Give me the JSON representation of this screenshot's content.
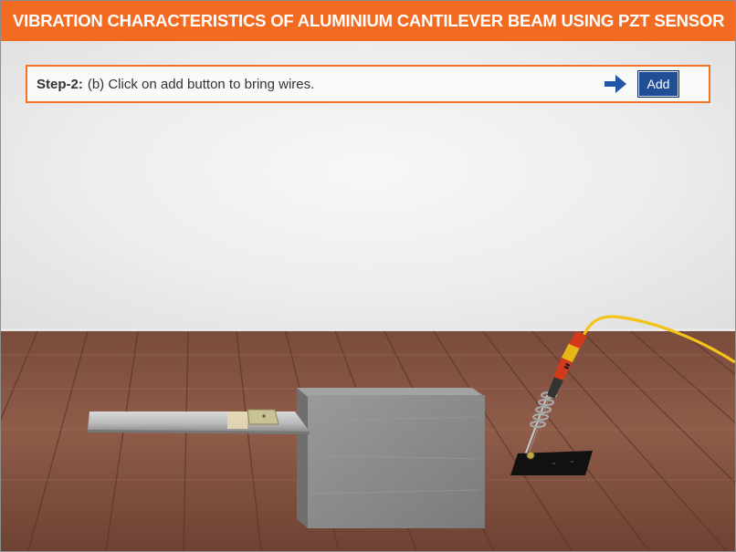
{
  "header": {
    "title": "VIBRATION CHARACTERISTICS OF ALUMINIUM CANTILEVER BEAM USING PZT SENSOR"
  },
  "instruction": {
    "step_label": "Step-2:",
    "step_text": "(b) Click on add button to bring wires.",
    "arrow_icon": "arrow-right-icon",
    "add_button_label": "Add"
  },
  "colors": {
    "title_bar": "#f26b21",
    "add_button": "#1f4d96",
    "step_border": "#f07326",
    "arrow": "#1f56a8",
    "wire": "#f3c319"
  }
}
